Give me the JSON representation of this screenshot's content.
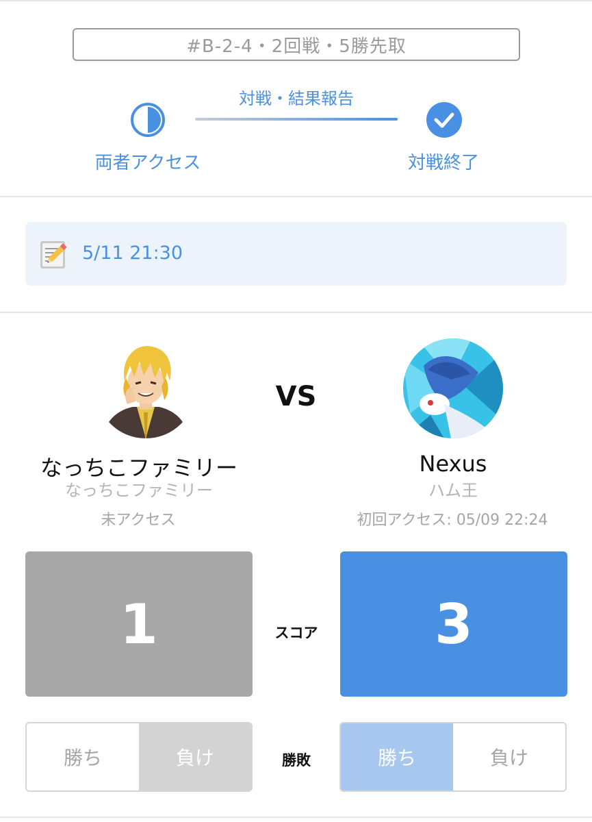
{
  "match": {
    "id_text": "#B-2-4・2回戦・5勝先取"
  },
  "progress": {
    "center_label": "対戦・結果報告",
    "step_left_label": "両者アクセス",
    "step_right_label": "対戦終了",
    "accent_color": "#4a90e2"
  },
  "schedule": {
    "datetime": "5/11 21:30",
    "icon": "memo-pencil-icon"
  },
  "vs_label": "VS",
  "players": {
    "left": {
      "name": "なっちこファミリー",
      "sub_name": "なっちこファミリー",
      "access_status": "未アクセス",
      "score": "1"
    },
    "right": {
      "name": "Nexus",
      "sub_name": "ハム王",
      "access_status": "初回アクセス: 05/09 22:24",
      "score": "3"
    }
  },
  "score_label": "スコア",
  "result": {
    "label": "勝敗",
    "win_text": "勝ち",
    "lose_text": "負け",
    "left_selected": "負け",
    "right_selected": "勝ち"
  }
}
